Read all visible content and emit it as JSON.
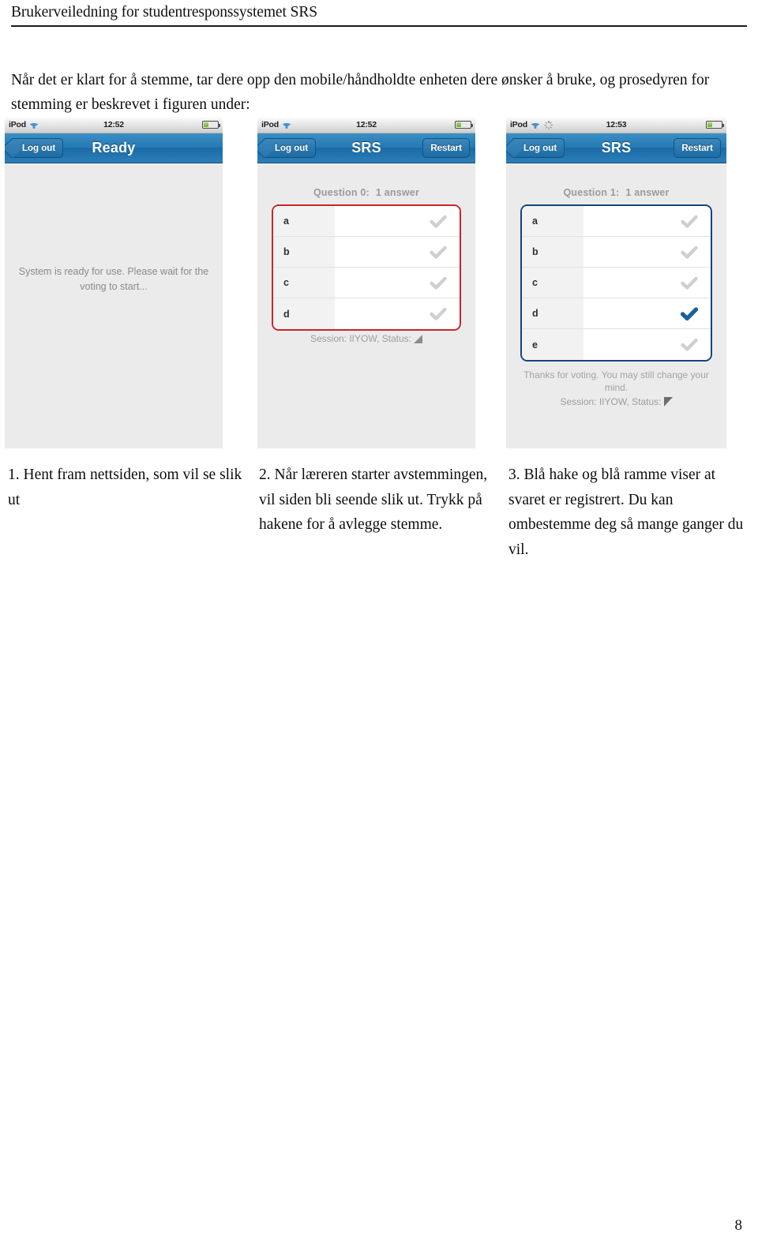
{
  "header": {
    "title": "Brukerveiledning for studentresponssystemet SRS"
  },
  "intro": {
    "text": "Når det er klart for å stemme, tar dere opp den mobile/håndholdte enheten dere ønsker å bruke, og prosedyren for stemming er beskrevet i figuren under:"
  },
  "figure": {
    "phones": [
      {
        "id": "phone-ready",
        "status_bar": {
          "carrier": "iPod",
          "wifi_icon": "wifi-icon",
          "spinner_icon": null,
          "time": "12:52",
          "battery_icon": "battery-icon"
        },
        "nav": {
          "back_label": "Log out",
          "title": "Ready",
          "right_label": null
        },
        "body_message": "System is ready for use. Please wait for the voting to start...",
        "question_label": null,
        "answer_count_label": null,
        "border_color": null,
        "options": [],
        "footer_message": null,
        "session_label": null,
        "status_icon": null
      },
      {
        "id": "phone-question-0",
        "status_bar": {
          "carrier": "iPod",
          "wifi_icon": "wifi-icon",
          "spinner_icon": null,
          "time": "12:52",
          "battery_icon": "battery-icon"
        },
        "nav": {
          "back_label": "Log out",
          "title": "SRS",
          "right_label": "Restart"
        },
        "body_message": null,
        "question_label": "Question 0:",
        "answer_count_label": "1 answer",
        "border_color": "#c7262b",
        "options": [
          {
            "label": "a",
            "selected": false
          },
          {
            "label": "b",
            "selected": false
          },
          {
            "label": "c",
            "selected": false
          },
          {
            "label": "d",
            "selected": false
          }
        ],
        "footer_message": null,
        "session_label": "Session: IIYOW, Status:",
        "status_icon": "signal-triangle-open-icon"
      },
      {
        "id": "phone-question-1",
        "status_bar": {
          "carrier": "iPod",
          "wifi_icon": "wifi-icon",
          "spinner_icon": "activity-spinner-icon",
          "time": "12:53",
          "battery_icon": "battery-icon"
        },
        "nav": {
          "back_label": "Log out",
          "title": "SRS",
          "right_label": "Restart"
        },
        "body_message": null,
        "question_label": "Question 1:",
        "answer_count_label": "1 answer",
        "border_color": "#12447c",
        "options": [
          {
            "label": "a",
            "selected": false
          },
          {
            "label": "b",
            "selected": false
          },
          {
            "label": "c",
            "selected": false
          },
          {
            "label": "d",
            "selected": true
          },
          {
            "label": "e",
            "selected": false
          }
        ],
        "footer_message": "Thanks for voting. You may still change your mind.",
        "session_label": "Session: IIYOW, Status:",
        "status_icon": "signal-triangle-solid-icon"
      }
    ]
  },
  "captions": [
    {
      "text": "1. Hent fram nettsiden, som vil se slik ut"
    },
    {
      "text": "2. Når læreren starter avstemmingen, vil siden bli seende slik ut. Trykk på hakene for å avlegge stemme."
    },
    {
      "text": "3. Blå hake og blå ramme viser at svaret er registrert. Du kan ombestemme deg så mange ganger du vil."
    }
  ],
  "page_number": "8",
  "colors": {
    "nav_blue": "#2479b4",
    "selected_check_blue": "#1a5f9e",
    "highlight_red": "#c7262b",
    "highlight_blue": "#12447c",
    "screen_background": "#ebebeb"
  }
}
